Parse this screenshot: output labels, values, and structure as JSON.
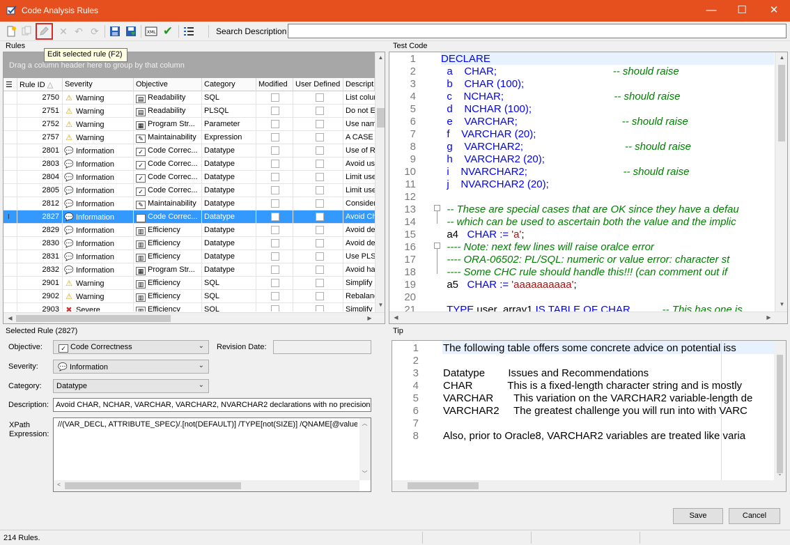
{
  "window": {
    "title": "Code Analysis Rules",
    "minimize": "—",
    "maximize": "☐",
    "close": "✕"
  },
  "toolbar": {
    "search_label": "Search Description",
    "search_value": "",
    "tooltip": "Edit selected rule (F2)",
    "icons": [
      "new-rule-icon",
      "copy-rule-icon",
      "edit-rule-icon",
      "delete-rule-icon",
      "undo-icon",
      "redo-icon",
      "save-icon",
      "save-as-icon",
      "xml-export-icon",
      "validate-icon",
      "list-icon"
    ]
  },
  "rules": {
    "section_label": "Rules",
    "group_hint": "Drag a column header here to group by that column",
    "columns": [
      "Rule ID",
      "Severity",
      "Objective",
      "Category",
      "Modified",
      "User Defined",
      "Descripti"
    ],
    "rows": [
      {
        "id": "2750",
        "severity": "Warning",
        "objective": "Readability",
        "category": "SQL",
        "desc": "List colum"
      },
      {
        "id": "2751",
        "severity": "Warning",
        "objective": "Readability",
        "category": "PLSQL",
        "desc": "Do not E"
      },
      {
        "id": "2752",
        "severity": "Warning",
        "objective": "Program Str...",
        "category": "Parameter",
        "desc": "Use nam"
      },
      {
        "id": "2757",
        "severity": "Warning",
        "objective": "Maintainability",
        "category": "Expression",
        "desc": "A CASE e"
      },
      {
        "id": "2801",
        "severity": "Information",
        "objective": "Code Correc...",
        "category": "Datatype",
        "desc": "Use of R"
      },
      {
        "id": "2803",
        "severity": "Information",
        "objective": "Code Correc...",
        "category": "Datatype",
        "desc": "Avoid us"
      },
      {
        "id": "2804",
        "severity": "Information",
        "objective": "Code Correc...",
        "category": "Datatype",
        "desc": "Limit use"
      },
      {
        "id": "2805",
        "severity": "Information",
        "objective": "Code Correc...",
        "category": "Datatype",
        "desc": "Limit use"
      },
      {
        "id": "2812",
        "severity": "Information",
        "objective": "Maintainability",
        "category": "Datatype",
        "desc": "Consider"
      },
      {
        "id": "2827",
        "severity": "Information",
        "objective": "Code Correc...",
        "category": "Datatype",
        "desc": "Avoid Ch",
        "selected": true
      },
      {
        "id": "2829",
        "severity": "Information",
        "objective": "Efficiency",
        "category": "Datatype",
        "desc": "Avoid de"
      },
      {
        "id": "2830",
        "severity": "Information",
        "objective": "Efficiency",
        "category": "Datatype",
        "desc": "Avoid de"
      },
      {
        "id": "2831",
        "severity": "Information",
        "objective": "Efficiency",
        "category": "Datatype",
        "desc": "Use PLS_"
      },
      {
        "id": "2832",
        "severity": "Information",
        "objective": "Program Str...",
        "category": "Datatype",
        "desc": "Avoid ha"
      },
      {
        "id": "2901",
        "severity": "Warning",
        "objective": "Efficiency",
        "category": "SQL",
        "desc": "Simplify N"
      },
      {
        "id": "2902",
        "severity": "Warning",
        "objective": "Efficiency",
        "category": "SQL",
        "desc": "Rebalanc"
      },
      {
        "id": "2903",
        "severity": "Severe",
        "objective": "Efficiency",
        "category": "SQL",
        "desc": "Simplify C"
      }
    ]
  },
  "test_code": {
    "section_label": "Test Code",
    "lines": [
      {
        "n": "1",
        "parts": [
          [
            "kw",
            "DECLARE"
          ]
        ]
      },
      {
        "n": "2",
        "parts": [
          [
            "kw",
            "  a    CHAR;"
          ],
          [
            "cm",
            "                                        -- should raise"
          ]
        ]
      },
      {
        "n": "3",
        "parts": [
          [
            "kw",
            "  b    CHAR (100);"
          ]
        ]
      },
      {
        "n": "4",
        "parts": [
          [
            "kw",
            "  c    NCHAR;"
          ],
          [
            "cm",
            "                                      -- should raise"
          ]
        ]
      },
      {
        "n": "5",
        "parts": [
          [
            "kw",
            "  d    NCHAR (100);"
          ]
        ]
      },
      {
        "n": "6",
        "parts": [
          [
            "kw",
            "  e    VARCHAR;"
          ],
          [
            "cm",
            "                                    -- should raise"
          ]
        ]
      },
      {
        "n": "7",
        "parts": [
          [
            "kw",
            "  f    VARCHAR (20);"
          ]
        ]
      },
      {
        "n": "8",
        "parts": [
          [
            "kw",
            "  g    VARCHAR2;"
          ],
          [
            "cm",
            "                                   -- should raise"
          ]
        ]
      },
      {
        "n": "9",
        "parts": [
          [
            "kw",
            "  h    VARCHAR2 (20);"
          ]
        ]
      },
      {
        "n": "10",
        "parts": [
          [
            "kw",
            "  i    NVARCHAR2;"
          ],
          [
            "cm",
            "                                 -- should raise"
          ]
        ]
      },
      {
        "n": "11",
        "parts": [
          [
            "kw",
            "  j    NVARCHAR2 (20);"
          ]
        ]
      },
      {
        "n": "12",
        "parts": [
          [
            "id",
            ""
          ]
        ]
      },
      {
        "n": "13",
        "parts": [
          [
            "cm",
            "  -- These are special cases that are OK since they have a defau"
          ]
        ]
      },
      {
        "n": "14",
        "parts": [
          [
            "cm",
            "  -- which can be used to ascertain both the value and the implic"
          ]
        ]
      },
      {
        "n": "15",
        "parts": [
          [
            "id",
            "  a4   "
          ],
          [
            "kw",
            "CHAR := "
          ],
          [
            "st",
            "'a'"
          ],
          [
            "id",
            ";"
          ]
        ]
      },
      {
        "n": "16",
        "parts": [
          [
            "cm",
            "  ---- Note: next few lines will raise oralce error"
          ]
        ]
      },
      {
        "n": "17",
        "parts": [
          [
            "cm",
            "  ---- ORA-06502: PL/SQL: numeric or value error: character st"
          ]
        ]
      },
      {
        "n": "18",
        "parts": [
          [
            "cm",
            "  ---- Some CHC rule should handle this!!! (can comment out if"
          ]
        ]
      },
      {
        "n": "19",
        "parts": [
          [
            "id",
            "  a5   "
          ],
          [
            "kw",
            "CHAR := "
          ],
          [
            "st",
            "'aaaaaaaaaa'"
          ],
          [
            "id",
            ";"
          ]
        ]
      },
      {
        "n": "20",
        "parts": [
          [
            "id",
            ""
          ]
        ]
      },
      {
        "n": "21",
        "parts": [
          [
            "kw",
            "  TYPE "
          ],
          [
            "id",
            "user_array1 "
          ],
          [
            "kw",
            "IS TABLE OF CHAR"
          ],
          [
            "cm",
            "           -- This has one is"
          ]
        ]
      }
    ]
  },
  "selected_rule": {
    "section_label": "Selected Rule (2827)",
    "objective_label": "Objective:",
    "objective_value": "Code Correctness",
    "revision_label": "Revision Date:",
    "revision_value": "",
    "severity_label": "Severity:",
    "severity_value": "Information",
    "category_label": "Category:",
    "category_value": "Datatype",
    "description_label": "Description:",
    "description_value": "Avoid CHAR, NCHAR, VARCHAR, VARCHAR2, NVARCHAR2 declarations with no precision.",
    "xpath_label_1": "XPath",
    "xpath_label_2": "Expression:",
    "xpath_value": "//(VAR_DECL, ATTRIBUTE_SPEC)/.[not(DEFAULT)] /TYPE[not(SIZE)] /QNAME[@value = ("
  },
  "tip": {
    "section_label": "Tip",
    "lines": [
      {
        "n": "1",
        "text": "The following table offers some concrete advice on potential iss"
      },
      {
        "n": "2",
        "text": ""
      },
      {
        "n": "3",
        "text": "Datatype        Issues and Recommendations"
      },
      {
        "n": "4",
        "text": "CHAR            This is a fixed-length character string and is mostly"
      },
      {
        "n": "5",
        "text": "VARCHAR       This variation on the VARCHAR2 variable-length de"
      },
      {
        "n": "6",
        "text": "VARCHAR2     The greatest challenge you will run into with VARC"
      },
      {
        "n": "7",
        "text": ""
      },
      {
        "n": "8",
        "text": "Also, prior to Oracle8, VARCHAR2 variables are treated like varia"
      }
    ]
  },
  "buttons": {
    "save": "Save",
    "cancel": "Cancel"
  },
  "status": {
    "text": "214 Rules."
  }
}
